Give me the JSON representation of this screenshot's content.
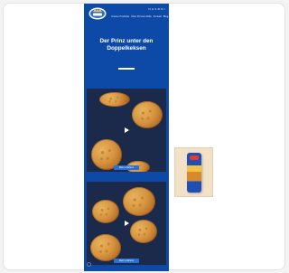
{
  "page": {
    "lang_label": "N A V D N /",
    "nav_items": [
      "Unsere Produkte",
      "Über Prinzen Rolle",
      "Kontakt",
      "Blog"
    ],
    "hero": {
      "title_line1": "Der Prinz unter den",
      "title_line2": "Doppelkeksen"
    },
    "videos": [
      {
        "cta_label": "Mehr erfahren"
      },
      {
        "cta_label": "Mehr erfahren"
      }
    ]
  },
  "icons": {
    "logo": "prinzen-rolle-logo",
    "play": "play-icon",
    "cursor": "circle-icon"
  },
  "colors": {
    "brand_blue": "#0d4aa8",
    "cookie": "#d6943f",
    "panel": "#f2e1c6"
  }
}
